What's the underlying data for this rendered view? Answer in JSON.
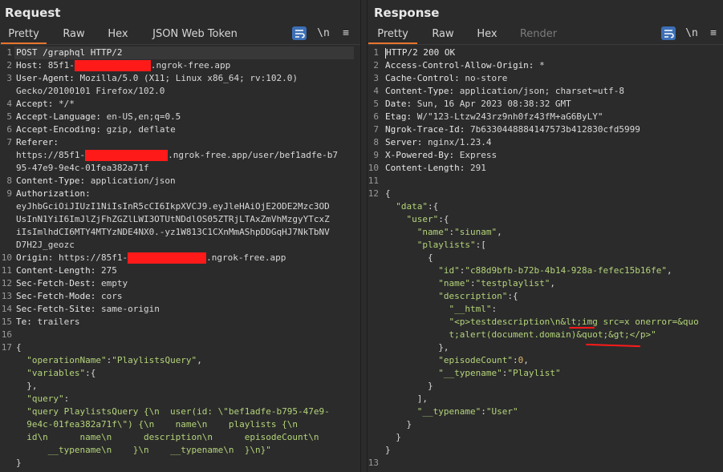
{
  "request": {
    "title": "Request",
    "tabs": [
      "Pretty",
      "Raw",
      "Hex",
      "JSON Web Token"
    ],
    "active_tab": "Pretty",
    "tools": {
      "newline": "\\n",
      "menu": "≡"
    },
    "lines": [
      {
        "n": "1",
        "segs": [
          [
            "k",
            "POST /graphql HTTP/2"
          ]
        ]
      },
      {
        "n": "2",
        "segs": [
          [
            "k",
            "Host: "
          ],
          [
            "p",
            "85f1-"
          ],
          [
            "redact",
            "95"
          ],
          [
            "p",
            ".ngrok-free.app"
          ]
        ]
      },
      {
        "n": "3",
        "segs": [
          [
            "k",
            "User-Agent: "
          ],
          [
            "p",
            "Mozilla/5.0 (X11; Linux x86_64; rv:102.0)"
          ]
        ]
      },
      {
        "n": "",
        "segs": [
          [
            "p",
            "Gecko/20100101 Firefox/102.0"
          ]
        ]
      },
      {
        "n": "4",
        "segs": [
          [
            "k",
            "Accept: "
          ],
          [
            "p",
            "*/*"
          ]
        ]
      },
      {
        "n": "5",
        "segs": [
          [
            "k",
            "Accept-Language: "
          ],
          [
            "p",
            "en-US,en;q=0.5"
          ]
        ]
      },
      {
        "n": "6",
        "segs": [
          [
            "k",
            "Accept-Encoding: "
          ],
          [
            "p",
            "gzip, deflate"
          ]
        ]
      },
      {
        "n": "7",
        "segs": [
          [
            "k",
            "Referer: "
          ]
        ]
      },
      {
        "n": "",
        "segs": [
          [
            "p",
            "https://85f1-"
          ],
          [
            "redact",
            "103"
          ],
          [
            "p",
            ".ngrok-free.app/user/bef1adfe-b7"
          ]
        ]
      },
      {
        "n": "",
        "segs": [
          [
            "p",
            "95-47e9-9e4c-01fea382a71f"
          ]
        ]
      },
      {
        "n": "8",
        "segs": [
          [
            "k",
            "Content-Type: "
          ],
          [
            "p",
            "application/json"
          ]
        ]
      },
      {
        "n": "9",
        "segs": [
          [
            "k",
            "Authorization:"
          ]
        ]
      },
      {
        "n": "",
        "segs": [
          [
            "p",
            "eyJhbGciOiJIUzI1NiIsInR5cCI6IkpXVCJ9.eyJleHAiOjE2ODE2Mzc3OD"
          ]
        ]
      },
      {
        "n": "",
        "segs": [
          [
            "p",
            "UsInN1YiI6ImJlZjFhZGZlLWI3OTUtNDdlOS05ZTRjLTAxZmVhMzgyYTcxZ"
          ]
        ]
      },
      {
        "n": "",
        "segs": [
          [
            "p",
            "iIsImlhdCI6MTY4MTYzNDE4NX0.-yz1W813C1CXnMmAShpDDGqHJ7NkTbNV"
          ]
        ]
      },
      {
        "n": "",
        "segs": [
          [
            "p",
            "D7H2J_geozc"
          ]
        ]
      },
      {
        "n": "10",
        "segs": [
          [
            "k",
            "Origin: "
          ],
          [
            "p",
            "https://85f1-"
          ],
          [
            "redact",
            "98"
          ],
          [
            "p",
            ".ngrok-free.app"
          ]
        ]
      },
      {
        "n": "11",
        "segs": [
          [
            "k",
            "Content-Length: "
          ],
          [
            "p",
            "275"
          ]
        ]
      },
      {
        "n": "12",
        "segs": [
          [
            "k",
            "Sec-Fetch-Dest: "
          ],
          [
            "p",
            "empty"
          ]
        ]
      },
      {
        "n": "13",
        "segs": [
          [
            "k",
            "Sec-Fetch-Mode: "
          ],
          [
            "p",
            "cors"
          ]
        ]
      },
      {
        "n": "14",
        "segs": [
          [
            "k",
            "Sec-Fetch-Site: "
          ],
          [
            "p",
            "same-origin"
          ]
        ]
      },
      {
        "n": "15",
        "segs": [
          [
            "k",
            "Te: "
          ],
          [
            "p",
            "trailers"
          ]
        ]
      },
      {
        "n": "16",
        "segs": []
      },
      {
        "n": "17",
        "segs": [
          [
            "p",
            "{"
          ]
        ]
      },
      {
        "n": "",
        "segs": [
          [
            "p",
            "  "
          ],
          [
            "s",
            "\"operationName\""
          ],
          [
            "p",
            ":"
          ],
          [
            "s",
            "\"PlaylistsQuery\""
          ],
          [
            "p",
            ","
          ]
        ]
      },
      {
        "n": "",
        "segs": [
          [
            "p",
            "  "
          ],
          [
            "s",
            "\"variables\""
          ],
          [
            "p",
            ":{"
          ]
        ]
      },
      {
        "n": "",
        "segs": [
          [
            "p",
            "  },"
          ]
        ]
      },
      {
        "n": "",
        "segs": [
          [
            "p",
            "  "
          ],
          [
            "s",
            "\"query\""
          ],
          [
            "p",
            ":"
          ]
        ]
      },
      {
        "n": "",
        "segs": [
          [
            "s",
            "  \"query PlaylistsQuery {\\n  user(id: \\\"bef1adfe-b795-47e9-"
          ]
        ]
      },
      {
        "n": "",
        "segs": [
          [
            "s",
            "  9e4c-01fea382a71f\\\") {\\n    name\\n    playlists {\\n"
          ]
        ]
      },
      {
        "n": "",
        "segs": [
          [
            "s",
            "  id\\n      name\\n      description\\n      episodeCount\\n"
          ]
        ]
      },
      {
        "n": "",
        "segs": [
          [
            "s",
            "      __typename\\n    }\\n    __typename\\n  }\\n}\""
          ]
        ]
      },
      {
        "n": "",
        "segs": [
          [
            "p",
            "}"
          ]
        ]
      }
    ]
  },
  "response": {
    "title": "Response",
    "tabs": [
      "Pretty",
      "Raw",
      "Hex",
      "Render"
    ],
    "active_tab": "Pretty",
    "disabled_tab": "Render",
    "tools": {
      "newline": "\\n",
      "menu": "≡"
    },
    "lines": [
      {
        "n": "1",
        "segs": [
          [
            "k",
            "HTTP/2 200 OK"
          ]
        ]
      },
      {
        "n": "2",
        "segs": [
          [
            "k",
            "Access-Control-Allow-Origin: "
          ],
          [
            "p",
            "*"
          ]
        ]
      },
      {
        "n": "3",
        "segs": [
          [
            "k",
            "Cache-Control: "
          ],
          [
            "p",
            "no-store"
          ]
        ]
      },
      {
        "n": "4",
        "segs": [
          [
            "k",
            "Content-Type: "
          ],
          [
            "p",
            "application/json; charset=utf-8"
          ]
        ]
      },
      {
        "n": "5",
        "segs": [
          [
            "k",
            "Date: "
          ],
          [
            "p",
            "Sun, 16 Apr 2023 08:38:32 GMT"
          ]
        ]
      },
      {
        "n": "6",
        "segs": [
          [
            "k",
            "Etag: "
          ],
          [
            "p",
            "W/\"123-Ltzw243rz9nh0fz43fM+aG6ByLY\""
          ]
        ]
      },
      {
        "n": "7",
        "segs": [
          [
            "k",
            "Ngrok-Trace-Id: "
          ],
          [
            "p",
            "7b6330448884147573b412830cfd5999"
          ]
        ]
      },
      {
        "n": "8",
        "segs": [
          [
            "k",
            "Server: "
          ],
          [
            "p",
            "nginx/1.23.4"
          ]
        ]
      },
      {
        "n": "9",
        "segs": [
          [
            "k",
            "X-Powered-By: "
          ],
          [
            "p",
            "Express"
          ]
        ]
      },
      {
        "n": "10",
        "segs": [
          [
            "k",
            "Content-Length: "
          ],
          [
            "p",
            "291"
          ]
        ]
      },
      {
        "n": "11",
        "segs": []
      },
      {
        "n": "12",
        "segs": [
          [
            "p",
            "{"
          ]
        ]
      },
      {
        "n": "",
        "segs": [
          [
            "p",
            "  "
          ],
          [
            "s",
            "\"data\""
          ],
          [
            "p",
            ":{"
          ]
        ]
      },
      {
        "n": "",
        "segs": [
          [
            "p",
            "    "
          ],
          [
            "s",
            "\"user\""
          ],
          [
            "p",
            ":{"
          ]
        ]
      },
      {
        "n": "",
        "segs": [
          [
            "p",
            "      "
          ],
          [
            "s",
            "\"name\""
          ],
          [
            "p",
            ":"
          ],
          [
            "s",
            "\"siunam\""
          ],
          [
            "p",
            ","
          ]
        ]
      },
      {
        "n": "",
        "segs": [
          [
            "p",
            "      "
          ],
          [
            "s",
            "\"playlists\""
          ],
          [
            "p",
            ":["
          ]
        ]
      },
      {
        "n": "",
        "segs": [
          [
            "p",
            "        {"
          ]
        ]
      },
      {
        "n": "",
        "segs": [
          [
            "p",
            "          "
          ],
          [
            "s",
            "\"id\""
          ],
          [
            "p",
            ":"
          ],
          [
            "s",
            "\"c88d9bfb-b72b-4b14-928a-fefec15b16fe\""
          ],
          [
            "p",
            ","
          ]
        ]
      },
      {
        "n": "",
        "segs": [
          [
            "p",
            "          "
          ],
          [
            "s",
            "\"name\""
          ],
          [
            "p",
            ":"
          ],
          [
            "s",
            "\"testplaylist\""
          ],
          [
            "p",
            ","
          ]
        ]
      },
      {
        "n": "",
        "segs": [
          [
            "p",
            "          "
          ],
          [
            "s",
            "\"description\""
          ],
          [
            "p",
            ":{"
          ]
        ]
      },
      {
        "n": "",
        "segs": [
          [
            "p",
            "            "
          ],
          [
            "s",
            "\"__html\""
          ],
          [
            "p",
            ":"
          ]
        ]
      },
      {
        "n": "",
        "segs": [
          [
            "s",
            "            \"<p>testdescription\\n&lt;img src=x onerror=&quo"
          ]
        ]
      },
      {
        "n": "",
        "segs": [
          [
            "s",
            "            t;alert(document.domain)&quot;&gt;</p>\""
          ]
        ]
      },
      {
        "n": "",
        "segs": [
          [
            "p",
            "          },"
          ]
        ]
      },
      {
        "n": "",
        "segs": [
          [
            "p",
            "          "
          ],
          [
            "s",
            "\"episodeCount\""
          ],
          [
            "p",
            ":"
          ],
          [
            "n",
            "0"
          ],
          [
            "p",
            ","
          ]
        ]
      },
      {
        "n": "",
        "segs": [
          [
            "p",
            "          "
          ],
          [
            "s",
            "\"__typename\""
          ],
          [
            "p",
            ":"
          ],
          [
            "s",
            "\"Playlist\""
          ]
        ]
      },
      {
        "n": "",
        "segs": [
          [
            "p",
            "        }"
          ]
        ]
      },
      {
        "n": "",
        "segs": [
          [
            "p",
            "      ],"
          ]
        ]
      },
      {
        "n": "",
        "segs": [
          [
            "p",
            "      "
          ],
          [
            "s",
            "\"__typename\""
          ],
          [
            "p",
            ":"
          ],
          [
            "s",
            "\"User\""
          ]
        ]
      },
      {
        "n": "",
        "segs": [
          [
            "p",
            "    }"
          ]
        ]
      },
      {
        "n": "",
        "segs": [
          [
            "p",
            "  }"
          ]
        ]
      },
      {
        "n": "",
        "segs": [
          [
            "p",
            "}"
          ]
        ]
      },
      {
        "n": "13",
        "segs": []
      }
    ]
  },
  "icons": {
    "format": "format-icon",
    "newline": "newline-icon",
    "menu": "menu-icon"
  },
  "colors": {
    "accent": "#e8742d",
    "button": "#3d6fb6",
    "redaction": "#ff1a1a",
    "string": "#b4d47a",
    "number": "#e0b868"
  }
}
